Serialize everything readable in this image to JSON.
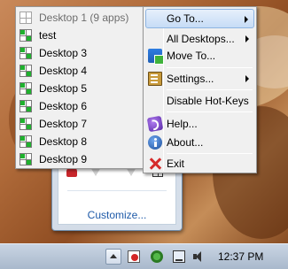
{
  "desktop_menu": {
    "items": [
      {
        "label": "Desktop 1 (9 apps)",
        "current": true,
        "green": false
      },
      {
        "label": "test",
        "current": false,
        "green": true
      },
      {
        "label": "Desktop 3",
        "current": false,
        "green": true
      },
      {
        "label": "Desktop 4",
        "current": false,
        "green": true
      },
      {
        "label": "Desktop 5",
        "current": false,
        "green": true
      },
      {
        "label": "Desktop 6",
        "current": false,
        "green": true
      },
      {
        "label": "Desktop 7",
        "current": false,
        "green": true
      },
      {
        "label": "Desktop 8",
        "current": false,
        "green": true
      },
      {
        "label": "Desktop 9",
        "current": false,
        "green": true
      }
    ]
  },
  "command_menu": {
    "goto_label": "Go To...",
    "all_desktops_label": "All Desktops...",
    "move_to_label": "Move To...",
    "settings_label": "Settings...",
    "disable_hotkeys_label": "Disable Hot-Keys",
    "help_label": "Help...",
    "about_label": "About...",
    "exit_label": "Exit"
  },
  "overflow": {
    "customize_label": "Customize..."
  },
  "taskbar": {
    "clock": "12:37 PM"
  },
  "colors": {
    "highlight": "#c6dcf6",
    "link": "#1e5aa8",
    "desktop_green": "#1fb12e"
  }
}
